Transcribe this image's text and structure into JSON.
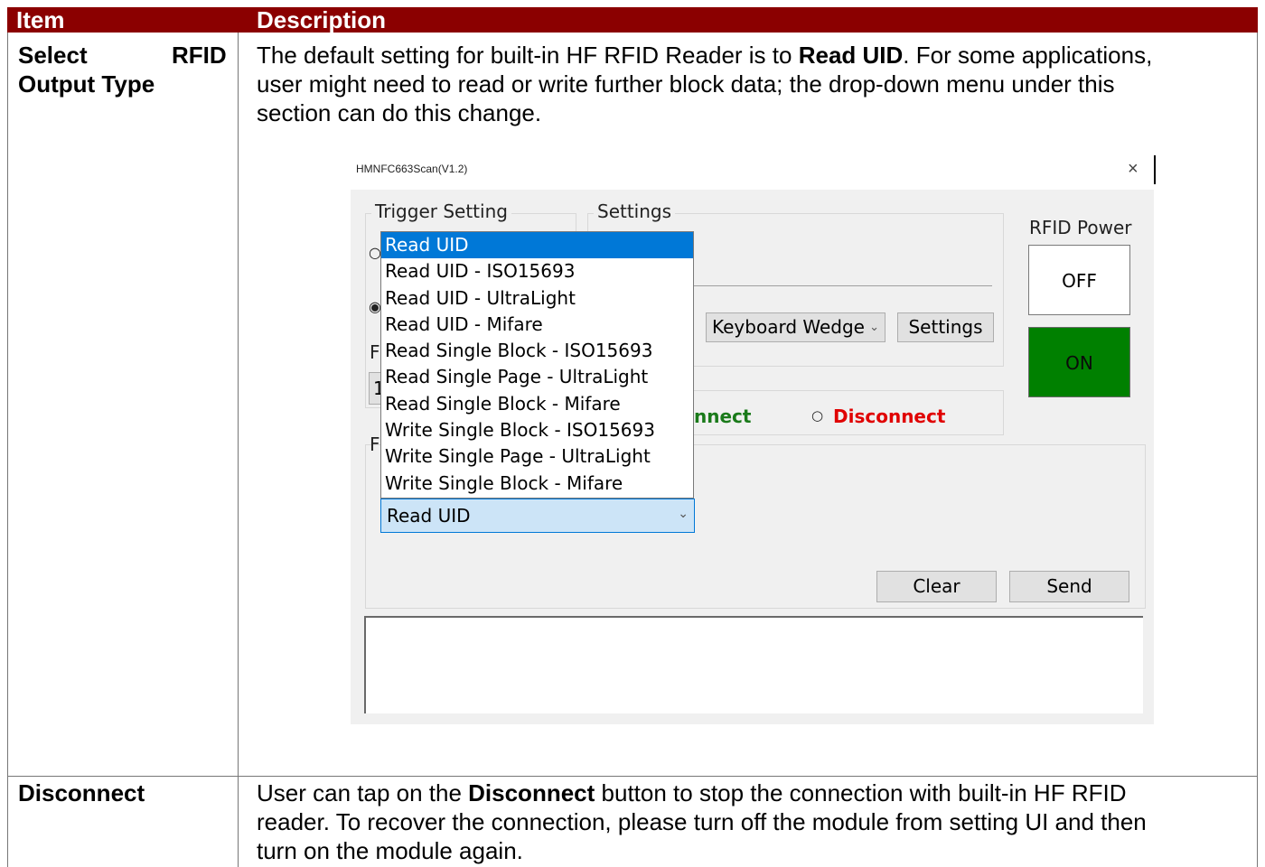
{
  "table": {
    "headers": [
      "Item",
      "Description"
    ],
    "rows": [
      {
        "item_line1a": "Select",
        "item_line1b": "RFID",
        "item_line2": "Output Type",
        "desc_line1_pre": "The default setting for built-in HF RFID Reader is to ",
        "desc_line1_bold": "Read UID",
        "desc_line1_post": ". For some applications,",
        "desc_line2": "user might need to read or write further block data; the drop-down menu under this",
        "desc_line3": "section can do this change."
      },
      {
        "item": "Disconnect",
        "desc_line1_pre": "User can tap on the ",
        "desc_line1_bold": "Disconnect",
        "desc_line1_post": " button to stop the connection with built-in HF RFID",
        "desc_line2": "reader. To recover the connection, please turn off the module from setting UI and then",
        "desc_line3": "turn on the module again."
      }
    ]
  },
  "app": {
    "window_title": "HMNFC663Scan(V1.2)",
    "close_glyph": "×",
    "trigger_group": "Trigger Setting",
    "settings_group": "Settings",
    "rfid_power_label": "RFID Power",
    "off_label": "OFF",
    "on_label": "ON",
    "on_color": "#008000",
    "output_select": "Keyboard Wedge",
    "settings_button": "Settings",
    "connect_partial": "nnect",
    "disconnect_label": "Disconnect",
    "connect_color": "#1a7a1a",
    "disconnect_color": "#e00000",
    "dropdown_selected": "Read UID",
    "dropdown_items": [
      "Read UID",
      "Read UID - ISO15693",
      "Read UID - UltraLight",
      "Read UID - Mifare",
      "Read Single Block - ISO15693",
      "Read Single Page - UltraLight",
      "Read Single Block - Mifare",
      "Write Single Block - ISO15693",
      "Write Single Page - UltraLight",
      "Write Single Block - Mifare"
    ],
    "clear_button": "Clear",
    "send_button": "Send",
    "partial_digit": "1",
    "partial_letter_f": "F"
  }
}
